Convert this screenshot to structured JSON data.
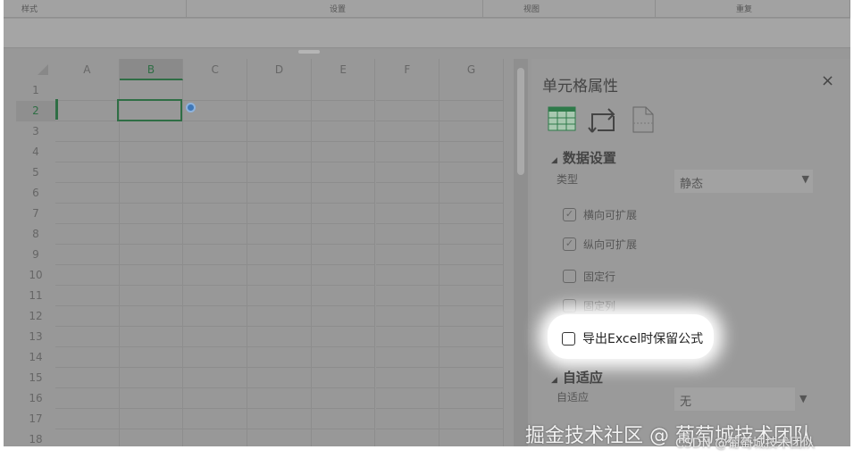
{
  "toolbar": {
    "tabs": [
      "样式",
      "设置",
      "视图",
      "重复"
    ]
  },
  "sheet": {
    "columns": [
      "A",
      "B",
      "C",
      "D",
      "E",
      "F",
      "G"
    ],
    "selected_column": "B",
    "rows": [
      "1",
      "2",
      "3",
      "4",
      "5",
      "6",
      "7",
      "8",
      "9",
      "10",
      "11",
      "12",
      "13",
      "14",
      "15",
      "16",
      "17",
      "18"
    ],
    "selected_row": "2"
  },
  "panel": {
    "title": "单元格属性",
    "close": "×",
    "data_section": "数据设置",
    "type_label": "类型",
    "type_value": "静态",
    "checkboxes": [
      {
        "label": "横向可扩展",
        "checked": true
      },
      {
        "label": "纵向可扩展",
        "checked": true
      },
      {
        "label": "固定行",
        "checked": false
      },
      {
        "label": "固定列",
        "checked": false
      },
      {
        "label": "导出Excel时保留公式",
        "checked": false
      }
    ],
    "adapt_section": "自适应",
    "adapt_label": "自适应",
    "adapt_value": "无"
  },
  "watermark": {
    "main": "掘金技术社区 @ 葡萄城技术团队",
    "sub": "CSDN @葡萄城技术团队"
  }
}
